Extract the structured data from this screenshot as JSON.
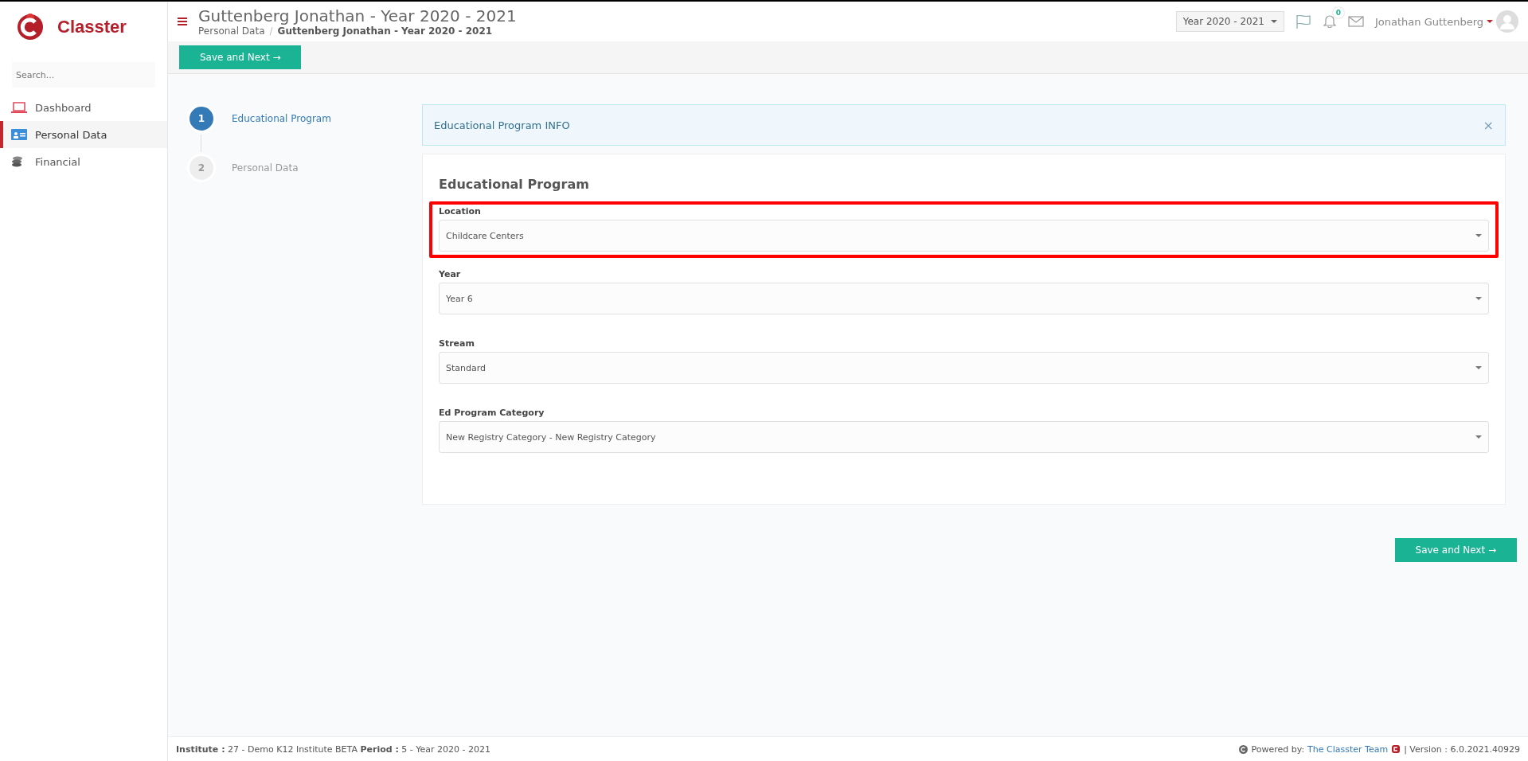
{
  "brand": {
    "name": "Classter"
  },
  "sidebar": {
    "search": {
      "placeholder": "Search..."
    },
    "items": [
      {
        "label": "Dashboard",
        "selected": false
      },
      {
        "label": "Personal Data",
        "selected": true
      },
      {
        "label": "Financial",
        "selected": false
      }
    ]
  },
  "header": {
    "title": "Guttenberg Jonathan - Year 2020 - 2021",
    "breadcrumb": [
      "Personal Data",
      "Guttenberg Jonathan - Year 2020 - 2021"
    ],
    "breadcrumb_separator": "/",
    "year_selector": "Year 2020 - 2021",
    "notification_count": "0",
    "user": "Jonathan Guttenberg"
  },
  "toolbar": {
    "button": "Save and Next →"
  },
  "steps": [
    {
      "number": "1",
      "label": "Educational Program",
      "selected": true
    },
    {
      "number": "2",
      "label": "Personal Data",
      "selected": false
    }
  ],
  "info": {
    "text": "Educational Program INFO",
    "close": "×"
  },
  "form": {
    "title": "Educational Program",
    "fields": [
      {
        "label": "Location",
        "value": "Childcare Centers",
        "highlighted": true
      },
      {
        "label": "Year",
        "value": "Year 6",
        "highlighted": false
      },
      {
        "label": "Stream",
        "value": "Standard",
        "highlighted": false
      },
      {
        "label": "Ed Program Category",
        "value": "New Registry Category - New Registry Category",
        "highlighted": false
      }
    ]
  },
  "bottom_button": "Save and Next →",
  "footer": {
    "info": "**Institute :** 27 - Demo K12 Institute BETA **Period :** 5 - Year 2020 - 2021",
    "powered_by": "Powered by:",
    "team_link": "The Classter Team",
    "version": "| Version : 6.0.2021.40929"
  }
}
